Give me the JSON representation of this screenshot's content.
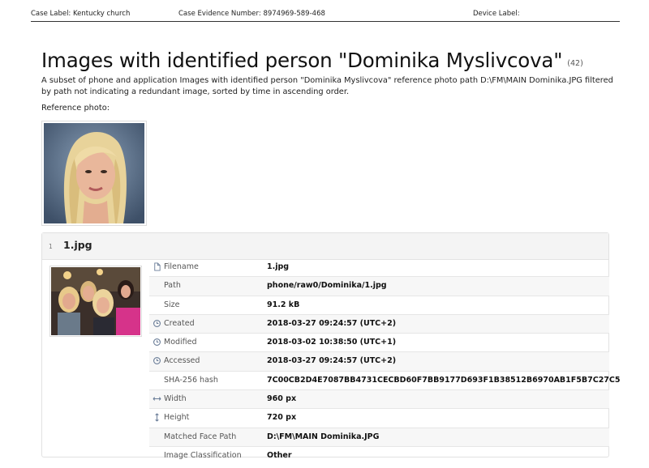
{
  "header": {
    "case_label": "Case Label:  Kentucky church",
    "evidence_number": "Case Evidence Number:  8974969-589-468",
    "device_label": "Device Label:"
  },
  "report": {
    "title": "Images with identified person \"Dominika Myslivcova\"",
    "count": "(42)",
    "description": "A subset of phone and application Images with identified person \"Dominika Myslivcova\" reference photo path D:\\FM\\MAIN Dominika.JPG filtered by path not indicating a redundant image, sorted by time in ascending order.",
    "reference_label": "Reference photo:"
  },
  "item": {
    "index": "1",
    "file_title": "1.jpg",
    "properties": [
      {
        "label": "Filename",
        "value": "1.jpg",
        "icon": "file-icon"
      },
      {
        "label": "Path",
        "value": "phone/raw0/Dominika/1.jpg",
        "icon": ""
      },
      {
        "label": "Size",
        "value": "91.2 kB",
        "icon": ""
      },
      {
        "label": "Created",
        "value": "2018-03-27 09:24:57 (UTC+2)",
        "icon": "clock-icon"
      },
      {
        "label": "Modified",
        "value": "2018-03-02 10:38:50 (UTC+1)",
        "icon": "clock-icon"
      },
      {
        "label": "Accessed",
        "value": "2018-03-27 09:24:57 (UTC+2)",
        "icon": "clock-icon"
      },
      {
        "label": "SHA-256 hash",
        "value": "7C00CB2D4E7087BB4731CECBD60F7BB9177D693F1B38512B6970AB1F5B7C27C5",
        "icon": ""
      },
      {
        "label": "Width",
        "value": "960 px",
        "icon": "width-arrow-icon"
      },
      {
        "label": "Height",
        "value": "720 px",
        "icon": "height-arrow-icon"
      },
      {
        "label": "Matched Face Path",
        "value": "D:\\FM\\MAIN Dominika.JPG",
        "icon": ""
      },
      {
        "label": "Image Classification",
        "value": "Other",
        "icon": ""
      }
    ]
  }
}
